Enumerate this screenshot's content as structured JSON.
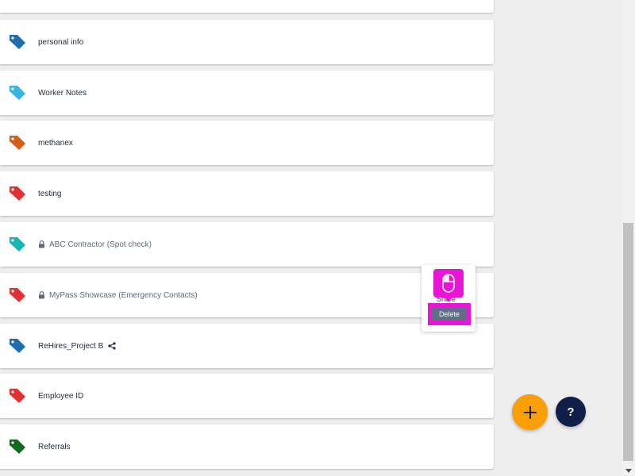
{
  "items": [
    {
      "label": "personal info",
      "color": "#1f6db0",
      "locked": false,
      "shared": false
    },
    {
      "label": "Worker Notes",
      "color": "#3cb3e0",
      "locked": false,
      "shared": false
    },
    {
      "label": "methanex",
      "color": "#d1601a",
      "locked": false,
      "shared": false
    },
    {
      "label": "testing",
      "color": "#e03232",
      "locked": false,
      "shared": false
    },
    {
      "label": "ABC Contractor (Spot check)",
      "color": "#18b5b5",
      "locked": true,
      "shared": false
    },
    {
      "label": "MyPass Showcase (Emergency Contacts)",
      "color": "#e03232",
      "locked": true,
      "shared": false
    },
    {
      "label": "ReHires_Project B",
      "color": "#1f6db0",
      "locked": false,
      "shared": true
    },
    {
      "label": "Employee ID",
      "color": "#e03232",
      "locked": false,
      "shared": false
    },
    {
      "label": "Referrals",
      "color": "#146a1e",
      "locked": false,
      "shared": false
    }
  ],
  "context_menu": {
    "share_label": "Share",
    "delete_label": "Delete"
  },
  "fab": {
    "add_icon": "plus-icon",
    "help_label": "?"
  },
  "colors": {
    "fab_add": "#f99f07",
    "fab_help": "#0f1f4a",
    "highlight": "#e815d6"
  }
}
